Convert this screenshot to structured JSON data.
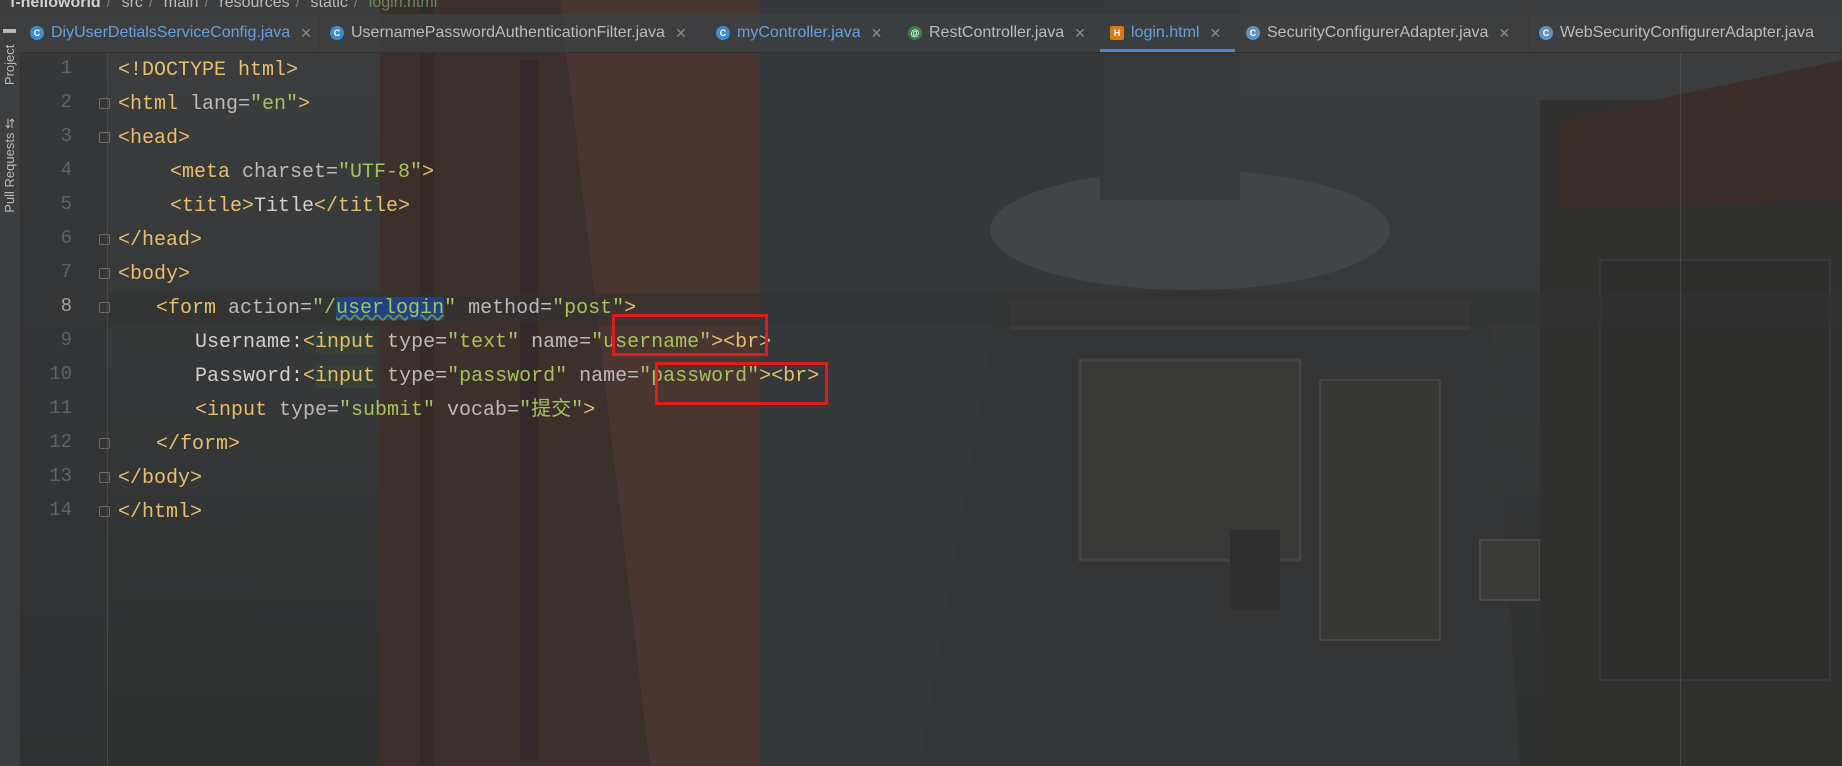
{
  "breadcrumb": [
    "f-helloworld",
    "src",
    "main",
    "resources",
    "static",
    "login.html"
  ],
  "toolstrip": {
    "project": "Project",
    "pull_requests": "Pull Requests"
  },
  "tabs": [
    {
      "label": "DiyUserDetialsServiceConfig.java",
      "icon": "class-icon",
      "style": "blue"
    },
    {
      "label": "UsernamePasswordAuthenticationFilter.java",
      "icon": "class-icon",
      "style": "normal"
    },
    {
      "label": "myController.java",
      "icon": "class-icon",
      "style": "blue"
    },
    {
      "label": "RestController.java",
      "icon": "annotation-icon",
      "style": "normal"
    },
    {
      "label": "login.html",
      "icon": "html-file-icon",
      "style": "active"
    },
    {
      "label": "SecurityConfigurerAdapter.java",
      "icon": "class-icon",
      "style": "normal"
    },
    {
      "label": "WebSecurityConfigurerAdapter.java",
      "icon": "class-icon",
      "style": "normal"
    }
  ],
  "line_numbers": [
    "1",
    "2",
    "3",
    "4",
    "5",
    "6",
    "7",
    "8",
    "9",
    "10",
    "11",
    "12",
    "13",
    "14"
  ],
  "current_line": "8",
  "code": {
    "l1": {
      "a": "<!DOCTYPE html>"
    },
    "l2": {
      "a": "<html ",
      "b": "lang=",
      "c": "\"en\"",
      "d": ">"
    },
    "l3": {
      "a": "<head>"
    },
    "l4": {
      "a": "<meta ",
      "b": "charset=",
      "c": "\"UTF-8\"",
      "d": ">"
    },
    "l5": {
      "a": "<title>",
      "b": "Title",
      "c": "</title>"
    },
    "l6": {
      "a": "</head>"
    },
    "l7": {
      "a": "<body>"
    },
    "l8": {
      "a": "<form ",
      "b": "action=",
      "c": "\"/",
      "sel": "userlogin",
      "d": "\" ",
      "e": "method=",
      "f": "\"post\"",
      "g": ">"
    },
    "l9": {
      "pre": "Username:",
      "a": "<",
      "kw": "input",
      "b": " type=",
      "c": "\"text\"",
      "d": " name=",
      "e": "\"username\"",
      "f": "><",
      "g": "br",
      "h": ">"
    },
    "l10": {
      "pre": "Password:",
      "a": "<",
      "kw": "input",
      "b": " type=",
      "c": "\"password\"",
      "d": " name=",
      "e": "\"password\"",
      "f": "><",
      "g": "br",
      "h": ">"
    },
    "l11": {
      "a": "<input ",
      "b": "type=",
      "c": "\"submit\"",
      "d": " vocab=",
      "e": "\"提交\"",
      "f": ">"
    },
    "l12": {
      "a": "</form>"
    },
    "l13": {
      "a": "</body>"
    },
    "l14": {
      "a": "</html>"
    }
  },
  "colors": {
    "tag": "#e8bf6a",
    "attr": "#bababa",
    "value": "#a5c25c",
    "annotation": "#e11b1b",
    "active_tab": "#4a88c7"
  }
}
